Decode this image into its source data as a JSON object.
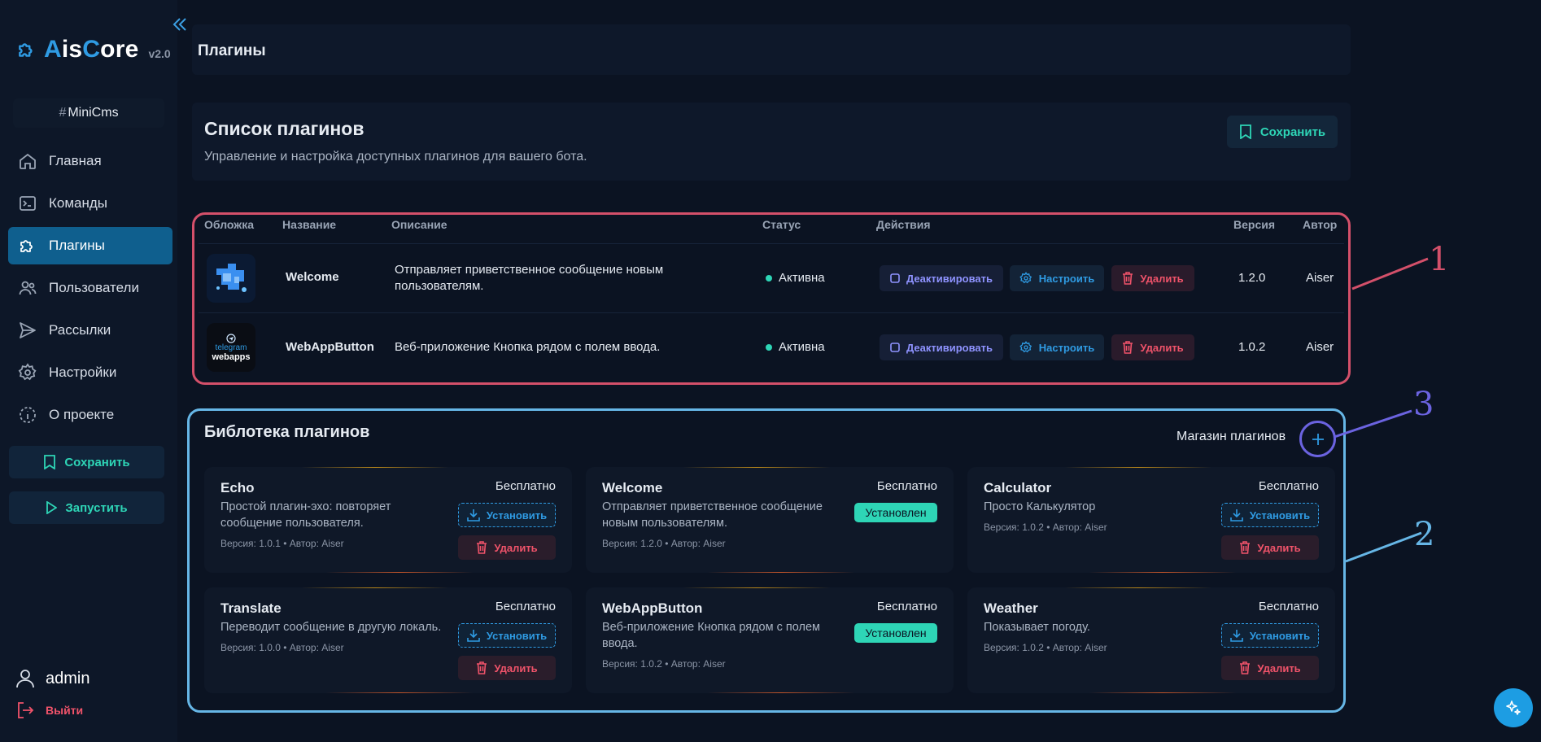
{
  "app": {
    "brand_a": "A",
    "brand_is": "is",
    "brand_c": "C",
    "brand_ore": "ore",
    "version": "v2.0",
    "project_hash": "#",
    "project": "MiniCms"
  },
  "sidebar": {
    "items": [
      {
        "label": "Главная",
        "icon": "home-icon"
      },
      {
        "label": "Команды",
        "icon": "terminal-icon"
      },
      {
        "label": "Плагины",
        "icon": "puzzle-icon",
        "active": true
      },
      {
        "label": "Пользователи",
        "icon": "users-icon"
      },
      {
        "label": "Рассылки",
        "icon": "send-icon"
      },
      {
        "label": "Настройки",
        "icon": "gear-icon"
      },
      {
        "label": "О проекте",
        "icon": "info-icon"
      }
    ],
    "save_label": "Сохранить",
    "run_label": "Запустить",
    "user": "admin",
    "logout": "Выйти"
  },
  "header": {
    "title": "Плагины"
  },
  "plugins_list": {
    "title": "Список плагинов",
    "subtitle": "Управление и настройка доступных плагинов для вашего бота.",
    "save_label": "Сохранить",
    "columns": [
      "Обложка",
      "Название",
      "Описание",
      "Статус",
      "Действия",
      "Версия",
      "Автор"
    ],
    "rows": [
      {
        "name": "Welcome",
        "description_l1": "Отправляет приветственное сообщение новым",
        "description_l2": "пользователям.",
        "status": "Активна",
        "version": "1.2.0",
        "author": "Aiser"
      },
      {
        "name": "WebAppButton",
        "description_l1": "Веб-приложение Кнопка рядом с полем ввода.",
        "description_l2": "",
        "status": "Активна",
        "version": "1.0.2",
        "author": "Aiser",
        "cover_l1": "telegram",
        "cover_l2": "webapps"
      }
    ],
    "actions": {
      "deactivate": "Деактивировать",
      "configure": "Настроить",
      "delete": "Удалить"
    }
  },
  "library": {
    "title": "Библотека плагинов",
    "store_label": "Магазин плагинов",
    "install_label": "Установить",
    "delete_label": "Удалить",
    "installed_label": "Установлен",
    "cards": [
      {
        "name": "Echo",
        "price": "Бесплатно",
        "desc": "Простой плагин-эхо: повторяет сообщение пользователя.",
        "meta": "Версия: 1.0.1 • Автор: Aiser",
        "installed": false
      },
      {
        "name": "Welcome",
        "price": "Бесплатно",
        "desc": "Отправляет приветственное сообщение новым пользователям.",
        "meta": "Версия: 1.2.0 • Автор: Aiser",
        "installed": true
      },
      {
        "name": "Calculator",
        "price": "Бесплатно",
        "desc": "Просто Калькулятор",
        "meta": "Версия: 1.0.2 • Автор: Aiser",
        "installed": false
      },
      {
        "name": "Translate",
        "price": "Бесплатно",
        "desc": "Переводит сообщение в другую локаль.",
        "meta": "Версия: 1.0.0 • Автор: Aiser",
        "installed": false
      },
      {
        "name": "WebAppButton",
        "price": "Бесплатно",
        "desc": "Веб-приложение Кнопка рядом с полем ввода.",
        "meta": "Версия: 1.0.2 • Автор: Aiser",
        "installed": true
      },
      {
        "name": "Weather",
        "price": "Бесплатно",
        "desc": "Показывает погоду.",
        "meta": "Версия: 1.0.2 • Автор: Aiser",
        "installed": false
      }
    ]
  },
  "annotations": [
    "1",
    "2",
    "3"
  ],
  "colors": {
    "accent": "#2f9be3",
    "success": "#2ed5b6",
    "danger": "#f0536a",
    "annotation_1": "#d4506a",
    "annotation_2": "#66b6e6",
    "annotation_3": "#6b63e0"
  }
}
